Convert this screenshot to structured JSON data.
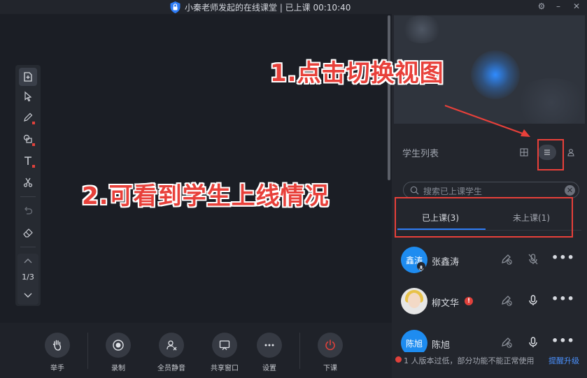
{
  "window": {
    "title": "小秦老师发起的在线课堂 | 已上课 00:10:40",
    "controls": [
      "settings-icon",
      "minimize-icon",
      "maximize-icon",
      "close-icon"
    ]
  },
  "whiteboard": {
    "tools": [
      "add-page-icon",
      "select-icon",
      "pen-icon",
      "shape-icon",
      "text-icon",
      "scissors-icon",
      "undo-icon",
      "eraser-icon"
    ],
    "pager": "1/3"
  },
  "bottom_bar": {
    "raise_hand": "举手",
    "record": "录制",
    "mute_all": "全员静音",
    "share_window": "共享窗口",
    "settings": "设置",
    "end_class": "下课"
  },
  "sidebar": {
    "student_list_title": "学生列表",
    "search_placeholder": "搜索已上课学生",
    "tabs": [
      {
        "label": "已上课(3)",
        "active": true
      },
      {
        "label": "未上课(1)",
        "active": false
      }
    ],
    "students": [
      {
        "name": "张鑫涛",
        "avatar_text": "鑫涛",
        "mic": "muted"
      },
      {
        "name": "柳文华",
        "avatar_text": "",
        "mic": "on",
        "warning": "!"
      },
      {
        "name": "陈旭",
        "avatar_text": "陈旭",
        "mic": "on"
      }
    ],
    "version_warning": "1 人版本过低，部分功能不能正常使用",
    "upgrade_link": "提醒升级"
  },
  "annotations": {
    "step1": "1.点击切换视图",
    "step2": "2.可看到学生上线情况"
  },
  "colors": {
    "accent": "#2e7cf6",
    "annotation_red": "#e8403a",
    "end_class_red": "#e0413b"
  }
}
